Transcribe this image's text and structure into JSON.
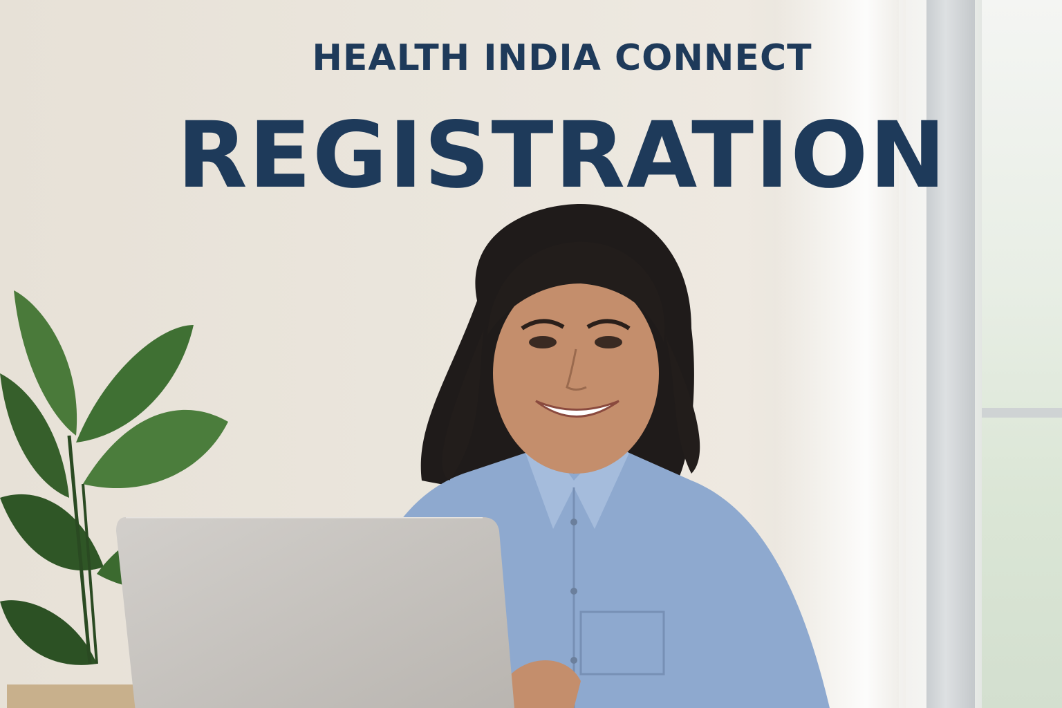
{
  "header": {
    "brand_title": "HEALTH INDIA CONNECT",
    "page_title": "REGISTRATION"
  },
  "colors": {
    "title": "#1e3a5a",
    "wall": "#ebe6dd",
    "shirt": "#8fa9cf",
    "laptop": "#c7c4c0",
    "plant": "#3f6e33"
  }
}
